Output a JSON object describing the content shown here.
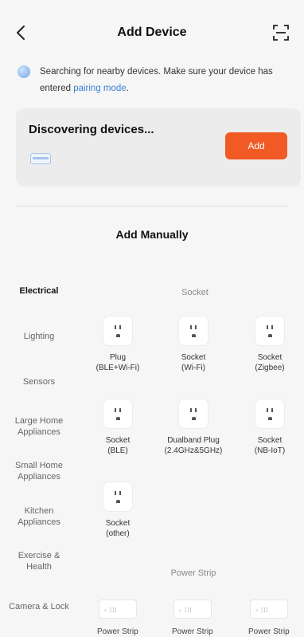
{
  "header": {
    "title": "Add Device",
    "back_icon": "chevron-left-icon",
    "scan_icon": "scan-icon"
  },
  "hint": {
    "text": "Searching for nearby devices. Make sure your device has entered ",
    "link": "pairing mode",
    "end": "."
  },
  "discovery": {
    "title": "Discovering devices...",
    "add_label": "Add",
    "accent_color": "#f15a24"
  },
  "manual": {
    "title": "Add Manually"
  },
  "categories": [
    {
      "label": "Electrical",
      "active": true
    },
    {
      "label": "Lighting",
      "active": false
    },
    {
      "label": "Sensors",
      "active": false
    },
    {
      "label": "Large Home Appliances",
      "active": false
    },
    {
      "label": "Small Home Appliances",
      "active": false
    },
    {
      "label": "Kitchen Appliances",
      "active": false
    },
    {
      "label": "Exercise & Health",
      "active": false
    },
    {
      "label": "Camera & Lock",
      "active": false
    }
  ],
  "sections": {
    "socket": "Socket",
    "power_strip": "Power Strip"
  },
  "devices": [
    {
      "line1": "Plug",
      "line2": "(BLE+Wi-Fi)"
    },
    {
      "line1": "Socket",
      "line2": "(Wi-Fi)"
    },
    {
      "line1": "Socket",
      "line2": "(Zigbee)"
    },
    {
      "line1": "Socket",
      "line2": "(BLE)"
    },
    {
      "line1": "Dualband Plug",
      "line2": "(2.4GHz&5GHz)"
    },
    {
      "line1": "Socket",
      "line2": "(NB-IoT)"
    },
    {
      "line1": "Socket",
      "line2": "(other)"
    }
  ],
  "power_strips": [
    "Power Strip",
    "Power Strip",
    "Power Strip"
  ]
}
